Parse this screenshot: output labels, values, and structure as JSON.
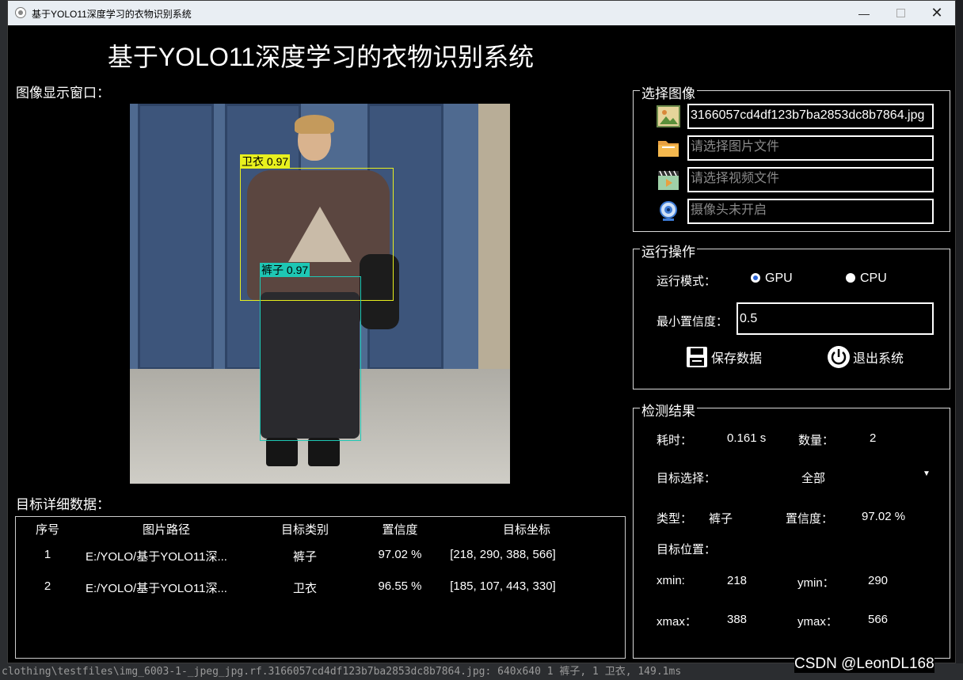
{
  "window": {
    "title": "基于YOLO11深度学习的衣物识别系统",
    "min_icon": "minimize-icon",
    "max_icon": "maximize-icon",
    "close_icon": "close-icon"
  },
  "header": {
    "title": "基于YOLO11深度学习的衣物识别系统"
  },
  "image_panel": {
    "label": "图像显示窗口："
  },
  "detections_overlay": [
    {
      "label": "卫衣 0.97",
      "color": "#e8f01e"
    },
    {
      "label": "裤子 0.97",
      "color": "#1ec7b4"
    }
  ],
  "select_image": {
    "group_title": "选择图像",
    "image_file_value": "3166057cd4df123b7ba2853dc8b7864.jpg",
    "folder_placeholder": "请选择图片文件",
    "video_placeholder": "请选择视频文件",
    "camera_placeholder": "摄像头未开启",
    "icons": [
      "image-icon",
      "folder-icon",
      "video-icon",
      "camera-icon"
    ]
  },
  "run_ops": {
    "group_title": "运行操作",
    "mode_label": "运行模式：",
    "gpu_label": "GPU",
    "cpu_label": "CPU",
    "selected_mode": "GPU",
    "conf_label": "最小置信度：",
    "conf_value": "0.5",
    "save_label": "保存数据",
    "exit_label": "退出系统"
  },
  "results": {
    "group_title": "检测结果",
    "time_label": "耗时：",
    "time_value": "0.161 s",
    "count_label": "数量：",
    "count_value": "2",
    "target_select_label": "目标选择：",
    "target_select_value": "全部",
    "type_label": "类型：",
    "type_value": "裤子",
    "conf_label": "置信度：",
    "conf_value": "97.02 %",
    "pos_label": "目标位置：",
    "xmin_label": "xmin:",
    "xmin_value": "218",
    "ymin_label": "ymin：",
    "ymin_value": "290",
    "xmax_label": "xmax：",
    "xmax_value": "388",
    "ymax_label": "ymax：",
    "ymax_value": "566"
  },
  "detail": {
    "label": "目标详细数据：",
    "columns": [
      "序号",
      "图片路径",
      "目标类别",
      "置信度",
      "目标坐标"
    ],
    "rows": [
      [
        "1",
        "E:/YOLO/基于YOLO11深...",
        "裤子",
        "97.02 %",
        "[218, 290, 388, 566]"
      ],
      [
        "2",
        "E:/YOLO/基于YOLO11深...",
        "卫衣",
        "96.55 %",
        "[185, 107, 443, 330]"
      ]
    ]
  },
  "background": {
    "status_text": "clothing\\testfiles\\img_6003-1-_jpeg_jpg.rf.3166057cd4df123b7ba2853dc8b7864.jpg: 640x640 1 裤子, 1 卫衣, 149.1ms",
    "watermark": "CSDN @LeonDL168"
  }
}
